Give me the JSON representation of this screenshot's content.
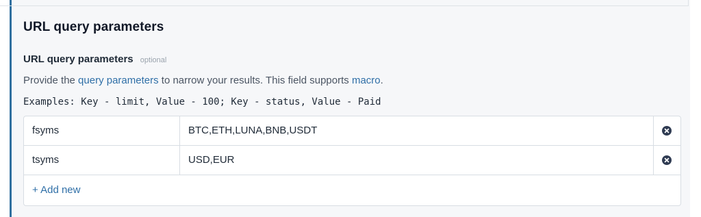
{
  "section": {
    "title": "URL query parameters"
  },
  "field": {
    "label": "URL query parameters",
    "optional_tag": "optional",
    "description_prefix": "Provide the ",
    "description_link": "query parameters",
    "description_middle": " to narrow your results. This field supports ",
    "description_macro_link": "macro",
    "description_suffix": ".",
    "examples": "Examples: Key - limit, Value - 100; Key - status, Value - Paid"
  },
  "params": [
    {
      "key": "fsyms",
      "value": "BTC,ETH,LUNA,BNB,USDT"
    },
    {
      "key": "tsyms",
      "value": "USD,EUR"
    }
  ],
  "add_new_label": "+ Add new",
  "colors": {
    "accent": "#2f6f9f",
    "link": "#2f6fa7",
    "remove_icon": "#2f3b52"
  },
  "icons": {
    "remove": "close-circle-icon"
  }
}
